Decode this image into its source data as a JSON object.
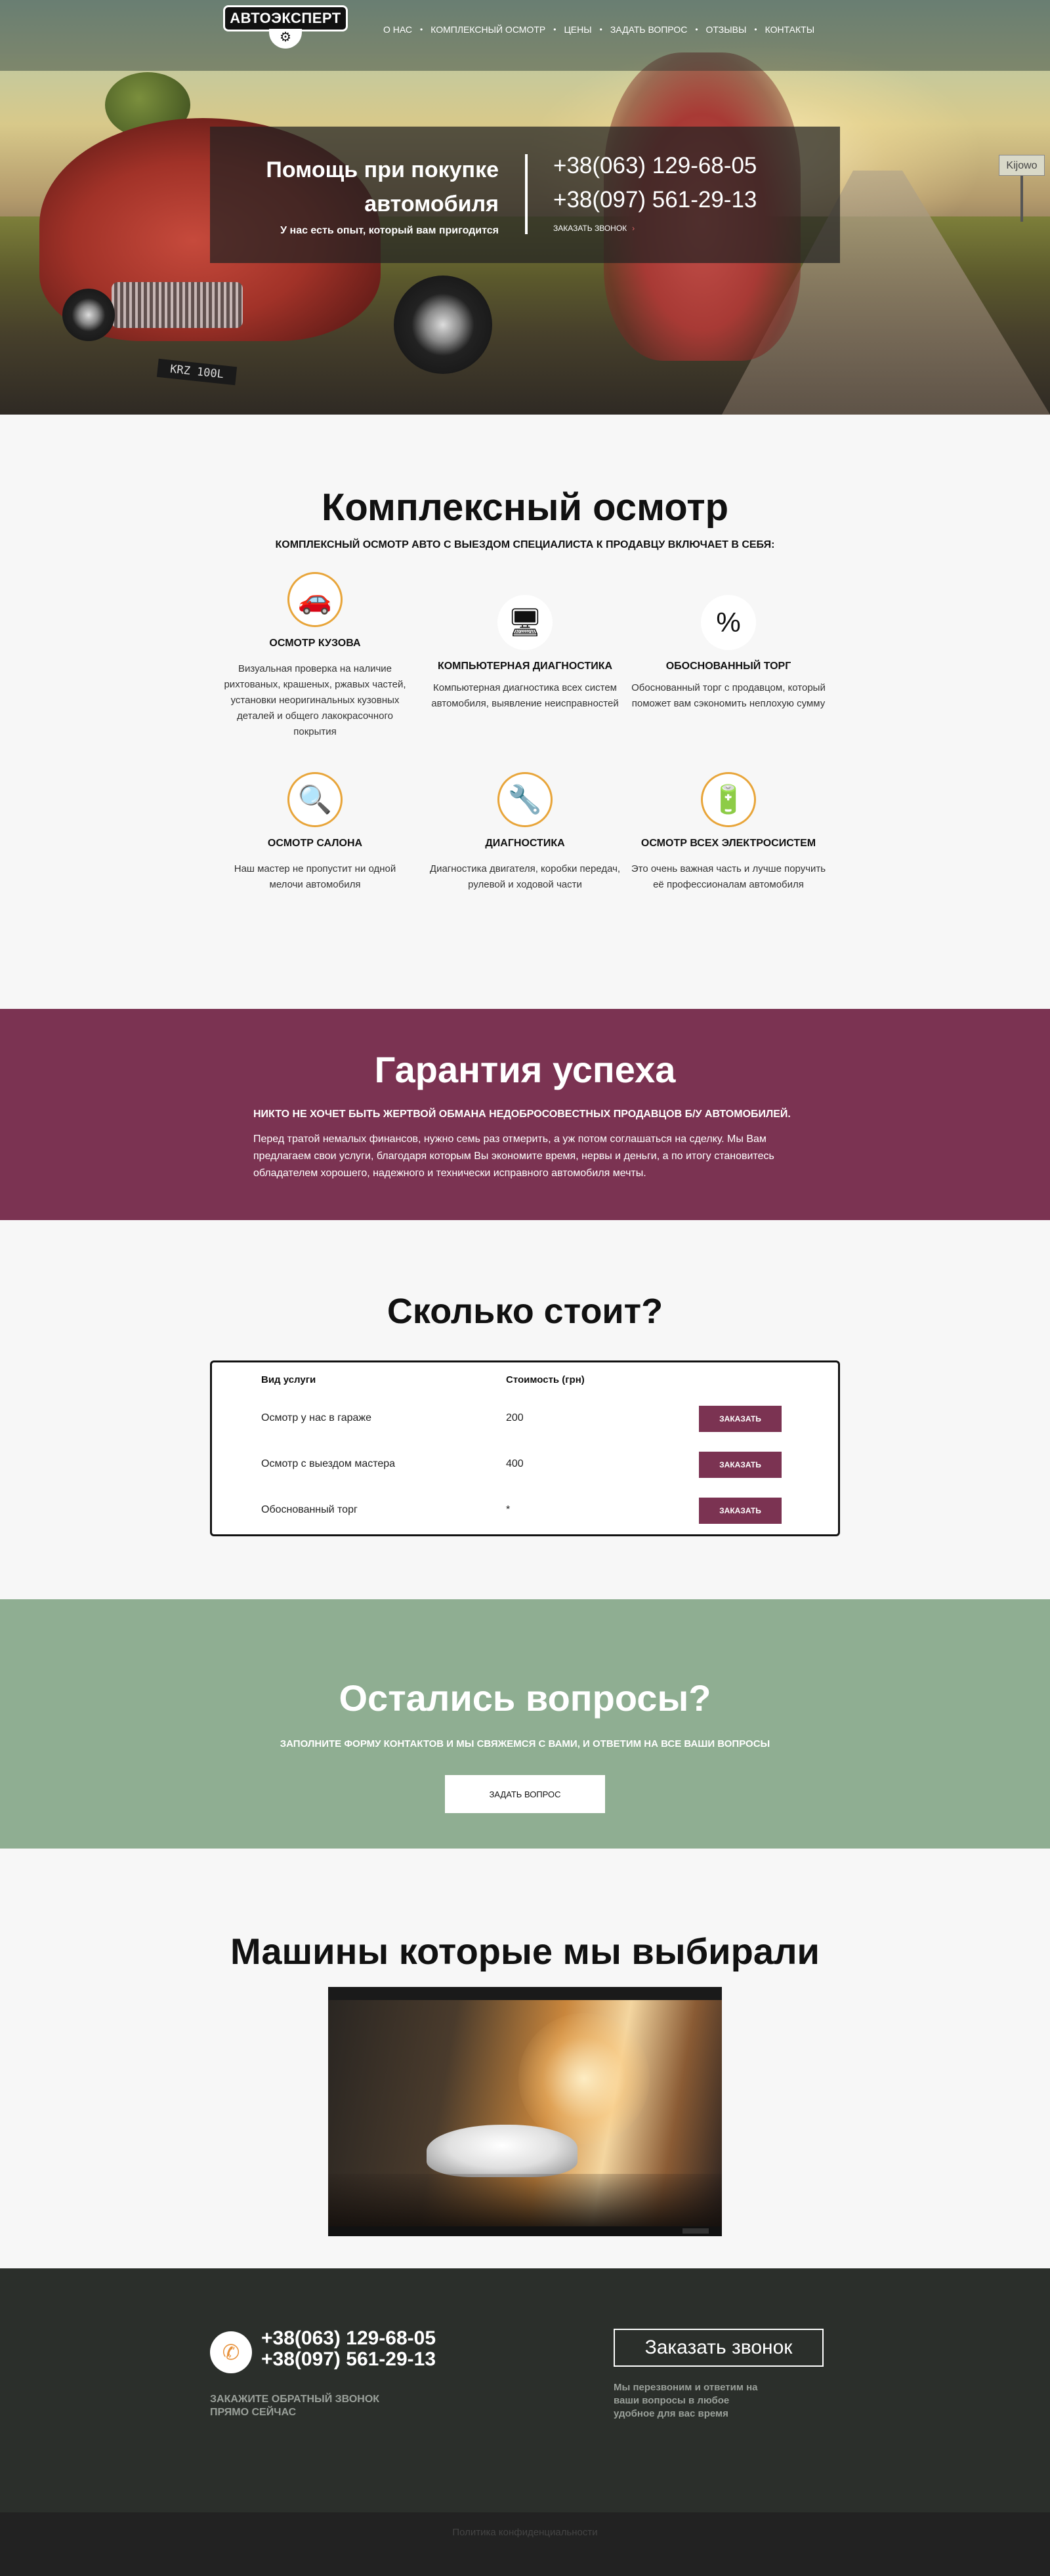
{
  "logo": {
    "text": "АВТОЭКСПЕРТ"
  },
  "nav": {
    "items": [
      "О НАС",
      "КОМПЛЕКСНЫЙ ОСМОТР",
      "ЦЕНЫ",
      "ЗАДАТЬ ВОПРОС",
      "ОТЗЫВЫ",
      "КОНТАКТЫ"
    ]
  },
  "hero": {
    "title_line1": "Помощь при покупке",
    "title_line2": "автомобиля",
    "subtitle": "У нас есть опыт, который вам пригодится",
    "phone1": "+38(063) 129-68-05",
    "phone2": "+38(097) 561-29-13",
    "callback": "ЗАКАЗАТЬ ЗВОНОК",
    "plate": "KRZ 100L",
    "road_sign": "Kijowo"
  },
  "inspection": {
    "title": "Комплексный осмотр",
    "subtitle": "КОМПЛЕКСНЫЙ ОСМОТР АВТО С ВЫЕЗДОМ СПЕЦИАЛИСТА К ПРОДАВЦУ ВКЛЮЧАЕТ В СЕБЯ:",
    "features": [
      {
        "title": "ОСМОТР КУЗОВА",
        "text": "Визуальная проверка на наличие рихтованых, крашеных, ржавых частей, установки неоригинальных кузовных деталей и общего лакокрасочного покрытия",
        "icon": "car-body-icon"
      },
      {
        "title": "КОМПЬЮТЕРНАЯ ДИАГНОСТИКА",
        "text": "Компьютерная диагностика всех систем автомобиля, выявление неисправностей",
        "icon": "monitor-icon"
      },
      {
        "title": "ОБОСНОВАННЫЙ ТОРГ",
        "text": "Обоснованный торг с продавцом, который поможет вам сэкономить неплохую сумму",
        "icon": "percent-icon"
      },
      {
        "title": "ОСМОТР САЛОНА",
        "text": "Наш мастер не пропустит ни одной мелочи автомобиля",
        "icon": "magnifier-icon"
      },
      {
        "title": "ДИАГНОСТИКА",
        "text": "Диагностика двигателя, коробки передач, рулевой и ходовой части",
        "icon": "tools-icon"
      },
      {
        "title": "ОСМОТР ВСЕХ ЭЛЕКТРОСИСТЕМ",
        "text": "Это очень важная часть и лучше поручить её профессионалам автомобиля",
        "icon": "battery-icon"
      }
    ]
  },
  "guarantee": {
    "title": "Гарантия успеха",
    "lead": "НИКТО НЕ ХОЧЕТ БЫТЬ ЖЕРТВОЙ ОБМАНА НЕДОБРОСОВЕСТНЫХ ПРОДАВЦОВ Б/У АВТОМОБИЛЕЙ.",
    "text": "Перед тратой немалых финансов, нужно семь раз отмерить, а уж потом соглашаться на сделку. Мы Вам предлагаем свои услуги, благодаря которым Вы экономите время, нервы и деньги, а по итогу становитесь обладателем хорошего, надежного и технически исправного автомобиля мечты."
  },
  "pricing": {
    "title": "Сколько стоит?",
    "col_service": "Вид услуги",
    "col_cost": "Стоимость (грн)",
    "order_label": "ЗАКАЗАТЬ",
    "rows": [
      {
        "service": "Осмотр у нас в гараже",
        "cost": "200"
      },
      {
        "service": "Осмотр с выездом мастера",
        "cost": "400"
      },
      {
        "service": "Обоснованный торг",
        "cost": "*"
      }
    ]
  },
  "questions": {
    "title": "Остались вопросы?",
    "subtitle": "ЗАПОЛНИТЕ ФОРМУ КОНТАКТОВ И МЫ СВЯЖЕМСЯ С ВАМИ, И ОТВЕТИМ НА ВСЕ ВАШИ ВОПРОСЫ",
    "button": "ЗАДАТЬ ВОПРОС"
  },
  "cars": {
    "title": "Машины которые мы выбирали"
  },
  "footer": {
    "phone1": "+38(063) 129-68-05",
    "phone2": "+38(097) 561-29-13",
    "note_line1": "ЗАКАЖИТЕ ОБРАТНЫЙ ЗВОНОК",
    "note_line2": "ПРЯМО СЕЙЧАС",
    "order_call": "Заказать звонок",
    "call_note": "Мы перезвоним и ответим на ваши вопросы в любое удобное для вас время",
    "policy": "Политика конфиденциальности"
  },
  "colors": {
    "accent": "#7b3352",
    "green": "#8fae92",
    "footer": "#2b2f2b",
    "icon_ring": "#e8a53a"
  }
}
